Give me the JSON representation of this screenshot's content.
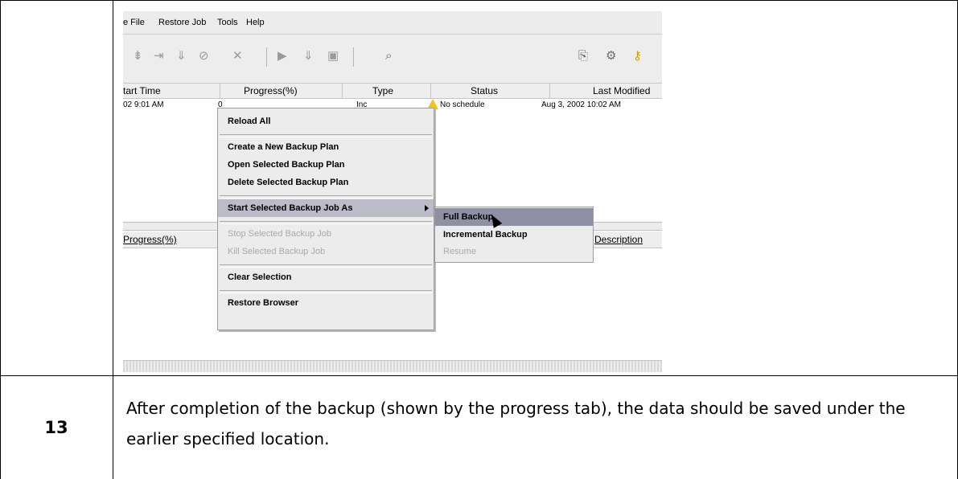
{
  "menubar": {
    "items": [
      "e File",
      "Restore Job",
      "Tools",
      "Help"
    ]
  },
  "grid": {
    "columns": [
      "tart Time",
      "Progress(%)",
      "Type",
      "Status",
      "Last Modified"
    ],
    "row": {
      "start_time": "02 9:01 AM",
      "progress": "0",
      "type": "Inc",
      "status": "No schedule",
      "last_modified": "Aug 3, 2002 10:02 AM"
    }
  },
  "lower_grid": {
    "columns": [
      "Progress(%)",
      "Description"
    ]
  },
  "context_menu": {
    "reload_all": "Reload All",
    "create_plan": "Create a New Backup Plan",
    "open_plan": "Open Selected Backup Plan",
    "delete_plan": "Delete Selected Backup Plan",
    "start_job_as": "Start Selected Backup Job As",
    "stop_job": "Stop Selected Backup Job",
    "kill_job": "Kill Selected Backup Job",
    "clear_selection": "Clear Selection",
    "restore_browser": "Restore Browser"
  },
  "submenu": {
    "full_backup": "Full Backup",
    "incremental_backup": "Incremental Backup",
    "resume": "Resume"
  },
  "step": {
    "number": "13",
    "text": "After completion of the backup (shown by the progress tab), the data should be saved under the earlier specified location."
  },
  "colors": {
    "menu_highlight": "#bcbcc9",
    "submenu_highlight": "#8f8fa6",
    "warning": "#f0c419"
  }
}
